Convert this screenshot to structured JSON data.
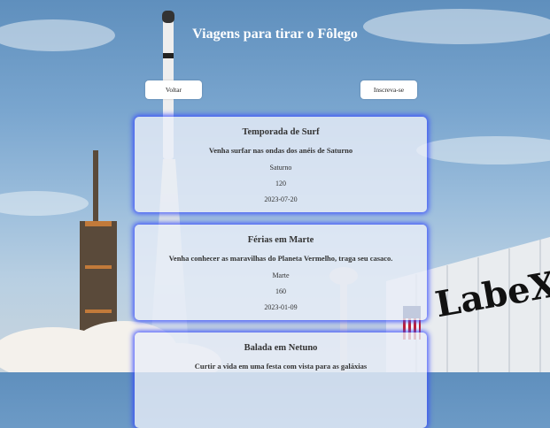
{
  "page": {
    "title": "Viagens para tirar o Fôlego"
  },
  "nav": {
    "back_label": "Voltar",
    "subscribe_label": "Inscreva-se"
  },
  "background": {
    "logo_text": "LabeX"
  },
  "trips": [
    {
      "name": "Temporada de Surf",
      "description": "Venha surfar nas ondas dos anéis de Saturno",
      "planet": "Saturno",
      "duration": "120",
      "date": "2023-07-20"
    },
    {
      "name": "Férias em Marte",
      "description": "Venha conhecer as maravilhas do Planeta Vermelho, traga seu casaco.",
      "planet": "Marte",
      "duration": "160",
      "date": "2023-01-09"
    },
    {
      "name": "Balada em Netuno",
      "description": "Curtir a vida em uma festa com vista para as galáxias",
      "planet": "",
      "duration": "",
      "date": ""
    }
  ]
}
